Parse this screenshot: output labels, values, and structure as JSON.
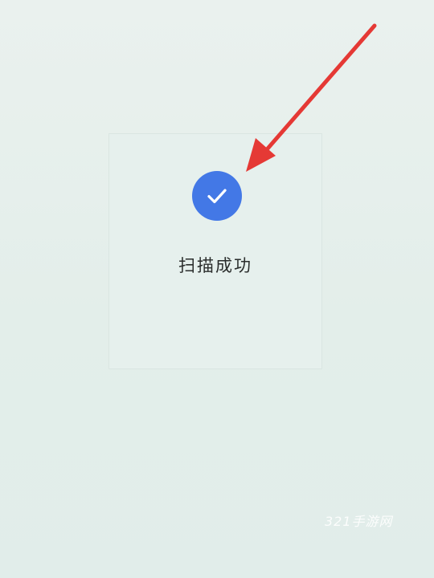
{
  "scan_result": {
    "status_text": "扫描成功",
    "success_icon": "check-icon",
    "accent_color": "#4378e6"
  },
  "annotation": {
    "pointer_icon": "arrow-icon",
    "color": "#e53935"
  },
  "watermark": {
    "text": "321手游网"
  }
}
